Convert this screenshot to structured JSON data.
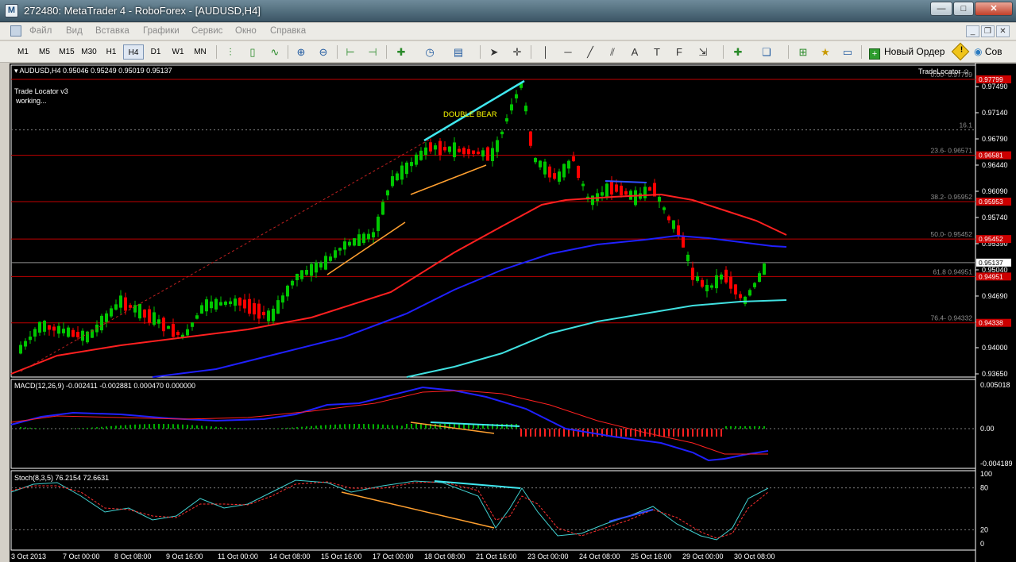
{
  "window": {
    "title": "272480: MetaTrader 4 - RoboForex - [AUDUSD,H4]",
    "minimize": "—",
    "maximize": "□",
    "close": "✕"
  },
  "menu": {
    "items": [
      "Файл",
      "Вид",
      "Вставка",
      "Графики",
      "Сервис",
      "Окно",
      "Справка"
    ]
  },
  "toolbar": {
    "timeframes": [
      "M1",
      "M5",
      "M15",
      "M30",
      "H1",
      "H4",
      "D1",
      "W1",
      "MN"
    ],
    "active_timeframe": "H4",
    "new_order_label": "Новый Ордер",
    "cut_label": "Сов"
  },
  "chart": {
    "symbol_info": "AUDUSD,H4  0.95046 0.95249 0.95019 0.95137",
    "indicator_name": "Trade Locator v3",
    "indicator_status": "working...",
    "top_right_label": "TradeLocator ☺",
    "pattern_label": "DOUBLE BEAR",
    "price_axis": [
      "0.97490",
      "0.97140",
      "0.96790",
      "0.96440",
      "0.96090",
      "0.95740",
      "0.95390",
      "0.95040",
      "0.94690",
      "0.94340",
      "0.94000",
      "0.93650"
    ],
    "fib_levels": [
      {
        "text": "0.00- 0.97799",
        "price_tag": "0.97799"
      },
      {
        "text": "16.1",
        "price_tag": ""
      },
      {
        "text": "23.6- 0.96571",
        "price_tag": "0.96581"
      },
      {
        "text": "38.2- 0.95952",
        "price_tag": "0.95953"
      },
      {
        "text": "50.0- 0.95452",
        "price_tag": "0.95452"
      },
      {
        "text": "61.8 0.94951",
        "price_tag": "0.94951"
      },
      {
        "text": "76.4- 0.94332",
        "price_tag": "0.94338"
      }
    ],
    "current_price": "0.95137",
    "time_axis": [
      "3 Oct 2013",
      "7 Oct 00:00",
      "8 Oct 08:00",
      "9 Oct 16:00",
      "11 Oct 00:00",
      "14 Oct 08:00",
      "15 Oct 16:00",
      "17 Oct 00:00",
      "18 Oct 08:00",
      "21 Oct 16:00",
      "23 Oct 00:00",
      "24 Oct 08:00",
      "25 Oct 16:00",
      "29 Oct 00:00",
      "30 Oct 08:00"
    ],
    "macd": {
      "title": "MACD(12,26,9) -0.002411 -0.002881 0.000470 0.000000",
      "axis": [
        "0.005018",
        "0.00",
        "-0.004189"
      ]
    },
    "stoch": {
      "title": "Stoch(8,3,5) 76.2154 72.6631",
      "axis": [
        "100",
        "80",
        "20",
        "0"
      ]
    },
    "colors": {
      "bull": "#00c800",
      "bear": "#ff0000",
      "ma_red": "#ff2020",
      "ma_blue": "#2020ff",
      "ma_cyan": "#40e0e0",
      "fib": "#c00000",
      "trend_orange": "#ffa030",
      "trend_cyan": "#40e8f0",
      "trend_blue": "#3050ff"
    }
  }
}
